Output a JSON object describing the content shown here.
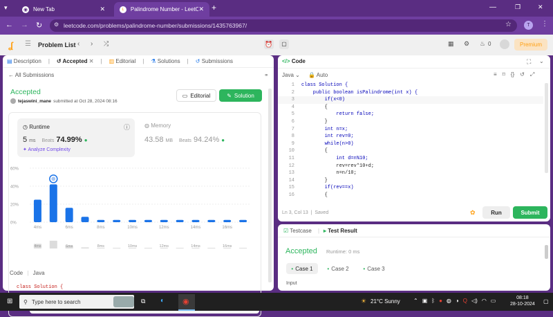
{
  "browser": {
    "tabs": [
      {
        "title": "New Tab"
      },
      {
        "title": "Palindrome Number - LeetCod"
      }
    ],
    "url": "leetcode.com/problems/palindrome-number/submissions/1435763967/",
    "profile_initial": "T"
  },
  "header": {
    "problem_list": "Problem List",
    "coins": "0",
    "premium": "Premium"
  },
  "left_tabs": [
    "Description",
    "Accepted",
    "Editorial",
    "Solutions",
    "Submissions"
  ],
  "submission": {
    "all_submissions": "All Submissions",
    "status": "Accepted",
    "user": "tejaswini_mane",
    "submitted_text": "submitted at Oct 28, 2024 08:16",
    "editorial_btn": "Editorial",
    "solution_btn": "Solution",
    "runtime_label": "Runtime",
    "runtime_value": "5",
    "runtime_unit": "ms",
    "beats_label": "Beats",
    "runtime_beats": "74.99%",
    "analyze": "Analyze Complexity",
    "memory_label": "Memory",
    "memory_value": "43.58",
    "memory_unit": "MB",
    "memory_beats": "94.24%"
  },
  "chart_data": {
    "type": "bar",
    "y_ticks": [
      "60%",
      "40%",
      "20%",
      "0%"
    ],
    "x_ticks": [
      "4ms",
      "6ms",
      "8ms",
      "10ms",
      "12ms",
      "14ms",
      "16ms"
    ],
    "mini_ticks": [
      "4ms",
      "6ms",
      "8ms",
      "10ms",
      "12ms",
      "14ms",
      "16ms"
    ],
    "values": [
      25,
      42,
      16,
      6,
      2.5,
      2.5,
      2.5,
      2.5,
      2.5,
      2.5,
      2.5,
      2.5,
      2.5,
      2.5
    ],
    "highlight_index": 1,
    "ylim": [
      0,
      60
    ],
    "bar_color": "#1a73e8"
  },
  "code_section": {
    "tab_code": "Code",
    "lang": "Java",
    "snippet": "class Solution {"
  },
  "editor": {
    "title": "Code",
    "language": "Java",
    "auto": "Auto",
    "status": "Ln 3, Col 13",
    "saved": "Saved",
    "run": "Run",
    "submit": "Submit",
    "lines": [
      "class Solution {",
      "    public boolean isPalindrome(int x) {",
      "        if(x<0)",
      "        {",
      "            return false;",
      "        }",
      "        int n=x;",
      "        int rev=0;",
      "        while(n>0)",
      "        {",
      "            int d=n%10;",
      "            rev=rev*10+d;",
      "            n=n/10;",
      "        }",
      "        if(rev==x)",
      "        {"
    ]
  },
  "result": {
    "testcase_tab": "Testcase",
    "result_tab": "Test Result",
    "status": "Accepted",
    "runtime": "Runtime: 0 ms",
    "cases": [
      "Case 1",
      "Case 2",
      "Case 3"
    ],
    "input_label": "Input"
  },
  "taskbar": {
    "search": "Type here to search",
    "weather": "21°C  Sunny",
    "time": "08:18",
    "date": "28-10-2024"
  },
  "colors": {
    "accent_green": "#2db55d",
    "browser_purple": "#5a2d82",
    "premium": "#ffa116"
  }
}
